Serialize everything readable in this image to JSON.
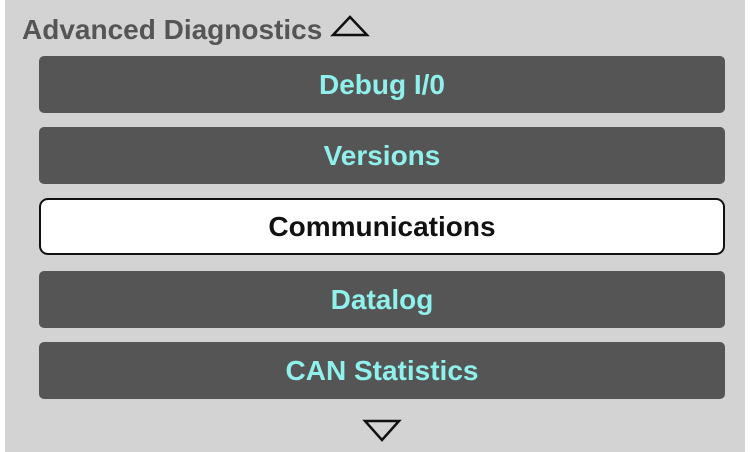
{
  "header": {
    "title": "Advanced Diagnostics",
    "collapse_icon": "triangle-up-outline-icon"
  },
  "menu": {
    "items": [
      {
        "label": "Debug I/0",
        "selected": false
      },
      {
        "label": "Versions",
        "selected": false
      },
      {
        "label": "Communications",
        "selected": true
      },
      {
        "label": "Datalog",
        "selected": false
      },
      {
        "label": "CAN Statistics",
        "selected": false
      }
    ]
  },
  "footer": {
    "scroll_icon": "triangle-down-outline-icon"
  },
  "colors": {
    "panel_background": "#d3d3d3",
    "button_background": "#555555",
    "button_text": "#8ff0ec",
    "selected_background": "#ffffff",
    "selected_text": "#111111",
    "header_text": "#555555"
  }
}
